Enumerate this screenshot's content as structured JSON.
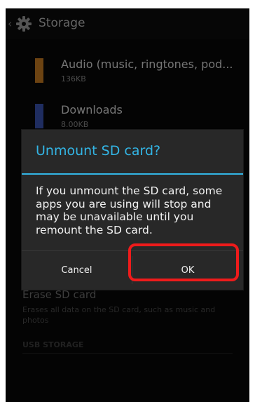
{
  "action_bar": {
    "title": "Storage"
  },
  "storage_items": [
    {
      "title": "Audio (music, ringtones, pod...",
      "size": "136KB",
      "color": "#c57a22"
    },
    {
      "title": "Downloads",
      "size": "8.00KB",
      "color": "#3a53b0"
    }
  ],
  "erase": {
    "title": "Erase SD card",
    "subtitle": "Erases all data on the SD card, such as music and photos"
  },
  "usb_storage": {
    "header": "USB STORAGE"
  },
  "dialog": {
    "title": "Unmount SD card?",
    "message": "If you unmount the SD card, some apps you are using will stop and may be unavailable until you remount the SD card.",
    "cancel_label": "Cancel",
    "ok_label": "OK"
  },
  "colors": {
    "accent": "#33b5e5",
    "highlight": "#ee1b1b"
  }
}
